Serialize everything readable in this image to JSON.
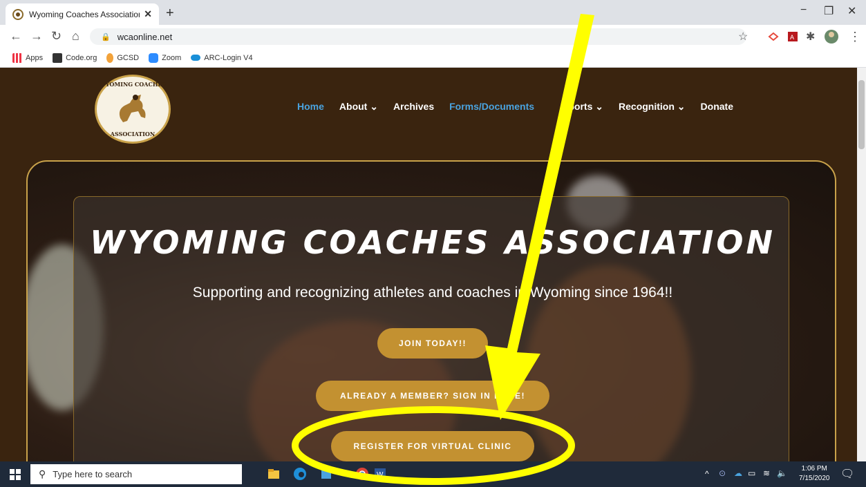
{
  "browser": {
    "tab_title": "Wyoming Coaches Association | ",
    "tab_close": "✕",
    "new_tab": "+",
    "url": "wcaonline.net",
    "bookmarks": [
      "Apps",
      "Code.org",
      "GCSD",
      "Zoom",
      "ARC-Login V4"
    ]
  },
  "site": {
    "logo_top": "WYOMING COACHES",
    "logo_bottom": "ASSOCIATION",
    "nav": [
      "Home",
      "About ⌄",
      "Archives",
      "Forms/Documents",
      "Sports ⌄",
      "Recognition ⌄",
      "Donate"
    ],
    "hero_title": "WYOMING COACHES ASSOCIATION",
    "hero_subtitle": "Supporting and recognizing athletes and coaches in Wyoming since 1964!!",
    "buttons": {
      "join": "JOIN TODAY!!",
      "sign_in": "ALREADY A MEMBER? SIGN IN HERE!",
      "register": "REGISTER FOR VIRTUAL CLINIC"
    }
  },
  "taskbar": {
    "search_placeholder": "Type here to search",
    "time": "1:06 PM",
    "date": "7/15/2020"
  },
  "colors": {
    "site_bg": "#3a240f",
    "accent_gold": "#c39131",
    "nav_active": "#4aa3df",
    "annotation_yellow": "#ffff00"
  }
}
